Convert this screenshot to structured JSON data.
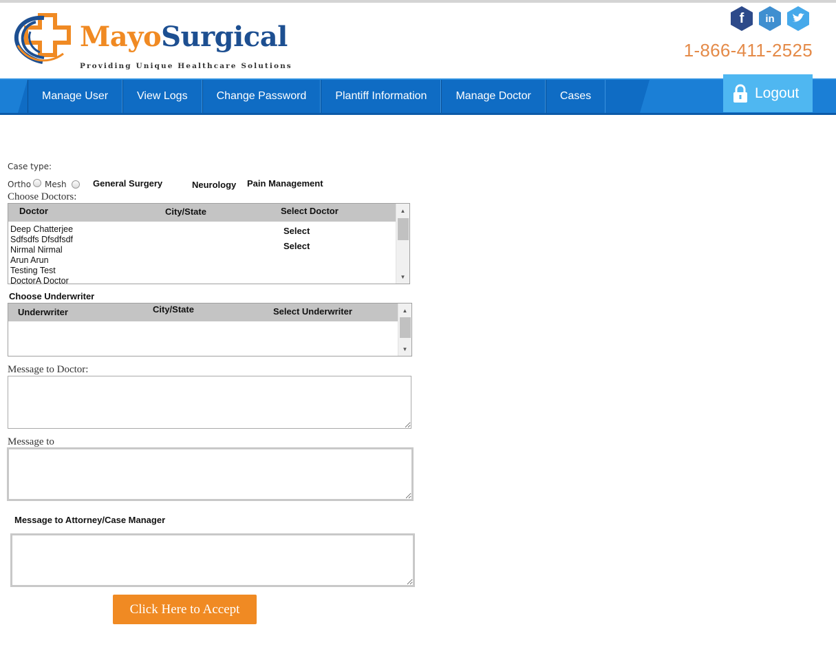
{
  "header": {
    "logo_mayo": "Mayo",
    "logo_surgical": "Surgical",
    "tagline": "Providing Unique Healthcare Solutions",
    "phone": "1-866-411-2525",
    "social": [
      {
        "name": "facebook-icon",
        "glyph": "f",
        "color": "#2d4a8a"
      },
      {
        "name": "linkedin-icon",
        "glyph": "in",
        "color": "#3f8fd0"
      },
      {
        "name": "twitter-icon",
        "glyph": "t",
        "color": "#46a9ea"
      }
    ]
  },
  "nav": {
    "items": [
      "Manage User",
      "View Logs",
      "Change Password",
      "Plantiff Information",
      "Manage Doctor",
      "Cases"
    ],
    "logout": "Logout"
  },
  "form": {
    "case_type_label": "Case type:",
    "ortho": "Ortho",
    "mesh": "Mesh",
    "general_surgery": "General Surgery",
    "neurology": "Neurology",
    "pain_management": "Pain Management",
    "choose_doctors": "Choose Doctors:",
    "doctor_table": {
      "headers": [
        "Doctor",
        "City/State",
        "Select Doctor"
      ],
      "doctors": [
        "Deep Chatterjee",
        "Sdfsdfs Dfsdfsdf",
        "Nirmal Nirmal",
        "Arun Arun",
        "Testing Test",
        "DoctorA Doctor"
      ],
      "select_labels": [
        "Select",
        "Select"
      ]
    },
    "choose_underwriter": "Choose Underwriter",
    "underwriter_table": {
      "headers": [
        "Underwriter",
        "City/State",
        "Select Underwriter"
      ]
    },
    "message_to_doctor": "Message to Doctor:",
    "message_to": "Message to",
    "message_to_attorney": "Message to Attorney/Case Manager",
    "accept_button": "Click Here to Accept"
  },
  "colors": {
    "brand_orange": "#f08a23",
    "brand_blue": "#1d4f91",
    "nav_blue": "#1b7fd6",
    "logout_blue": "#4fb7f1"
  }
}
